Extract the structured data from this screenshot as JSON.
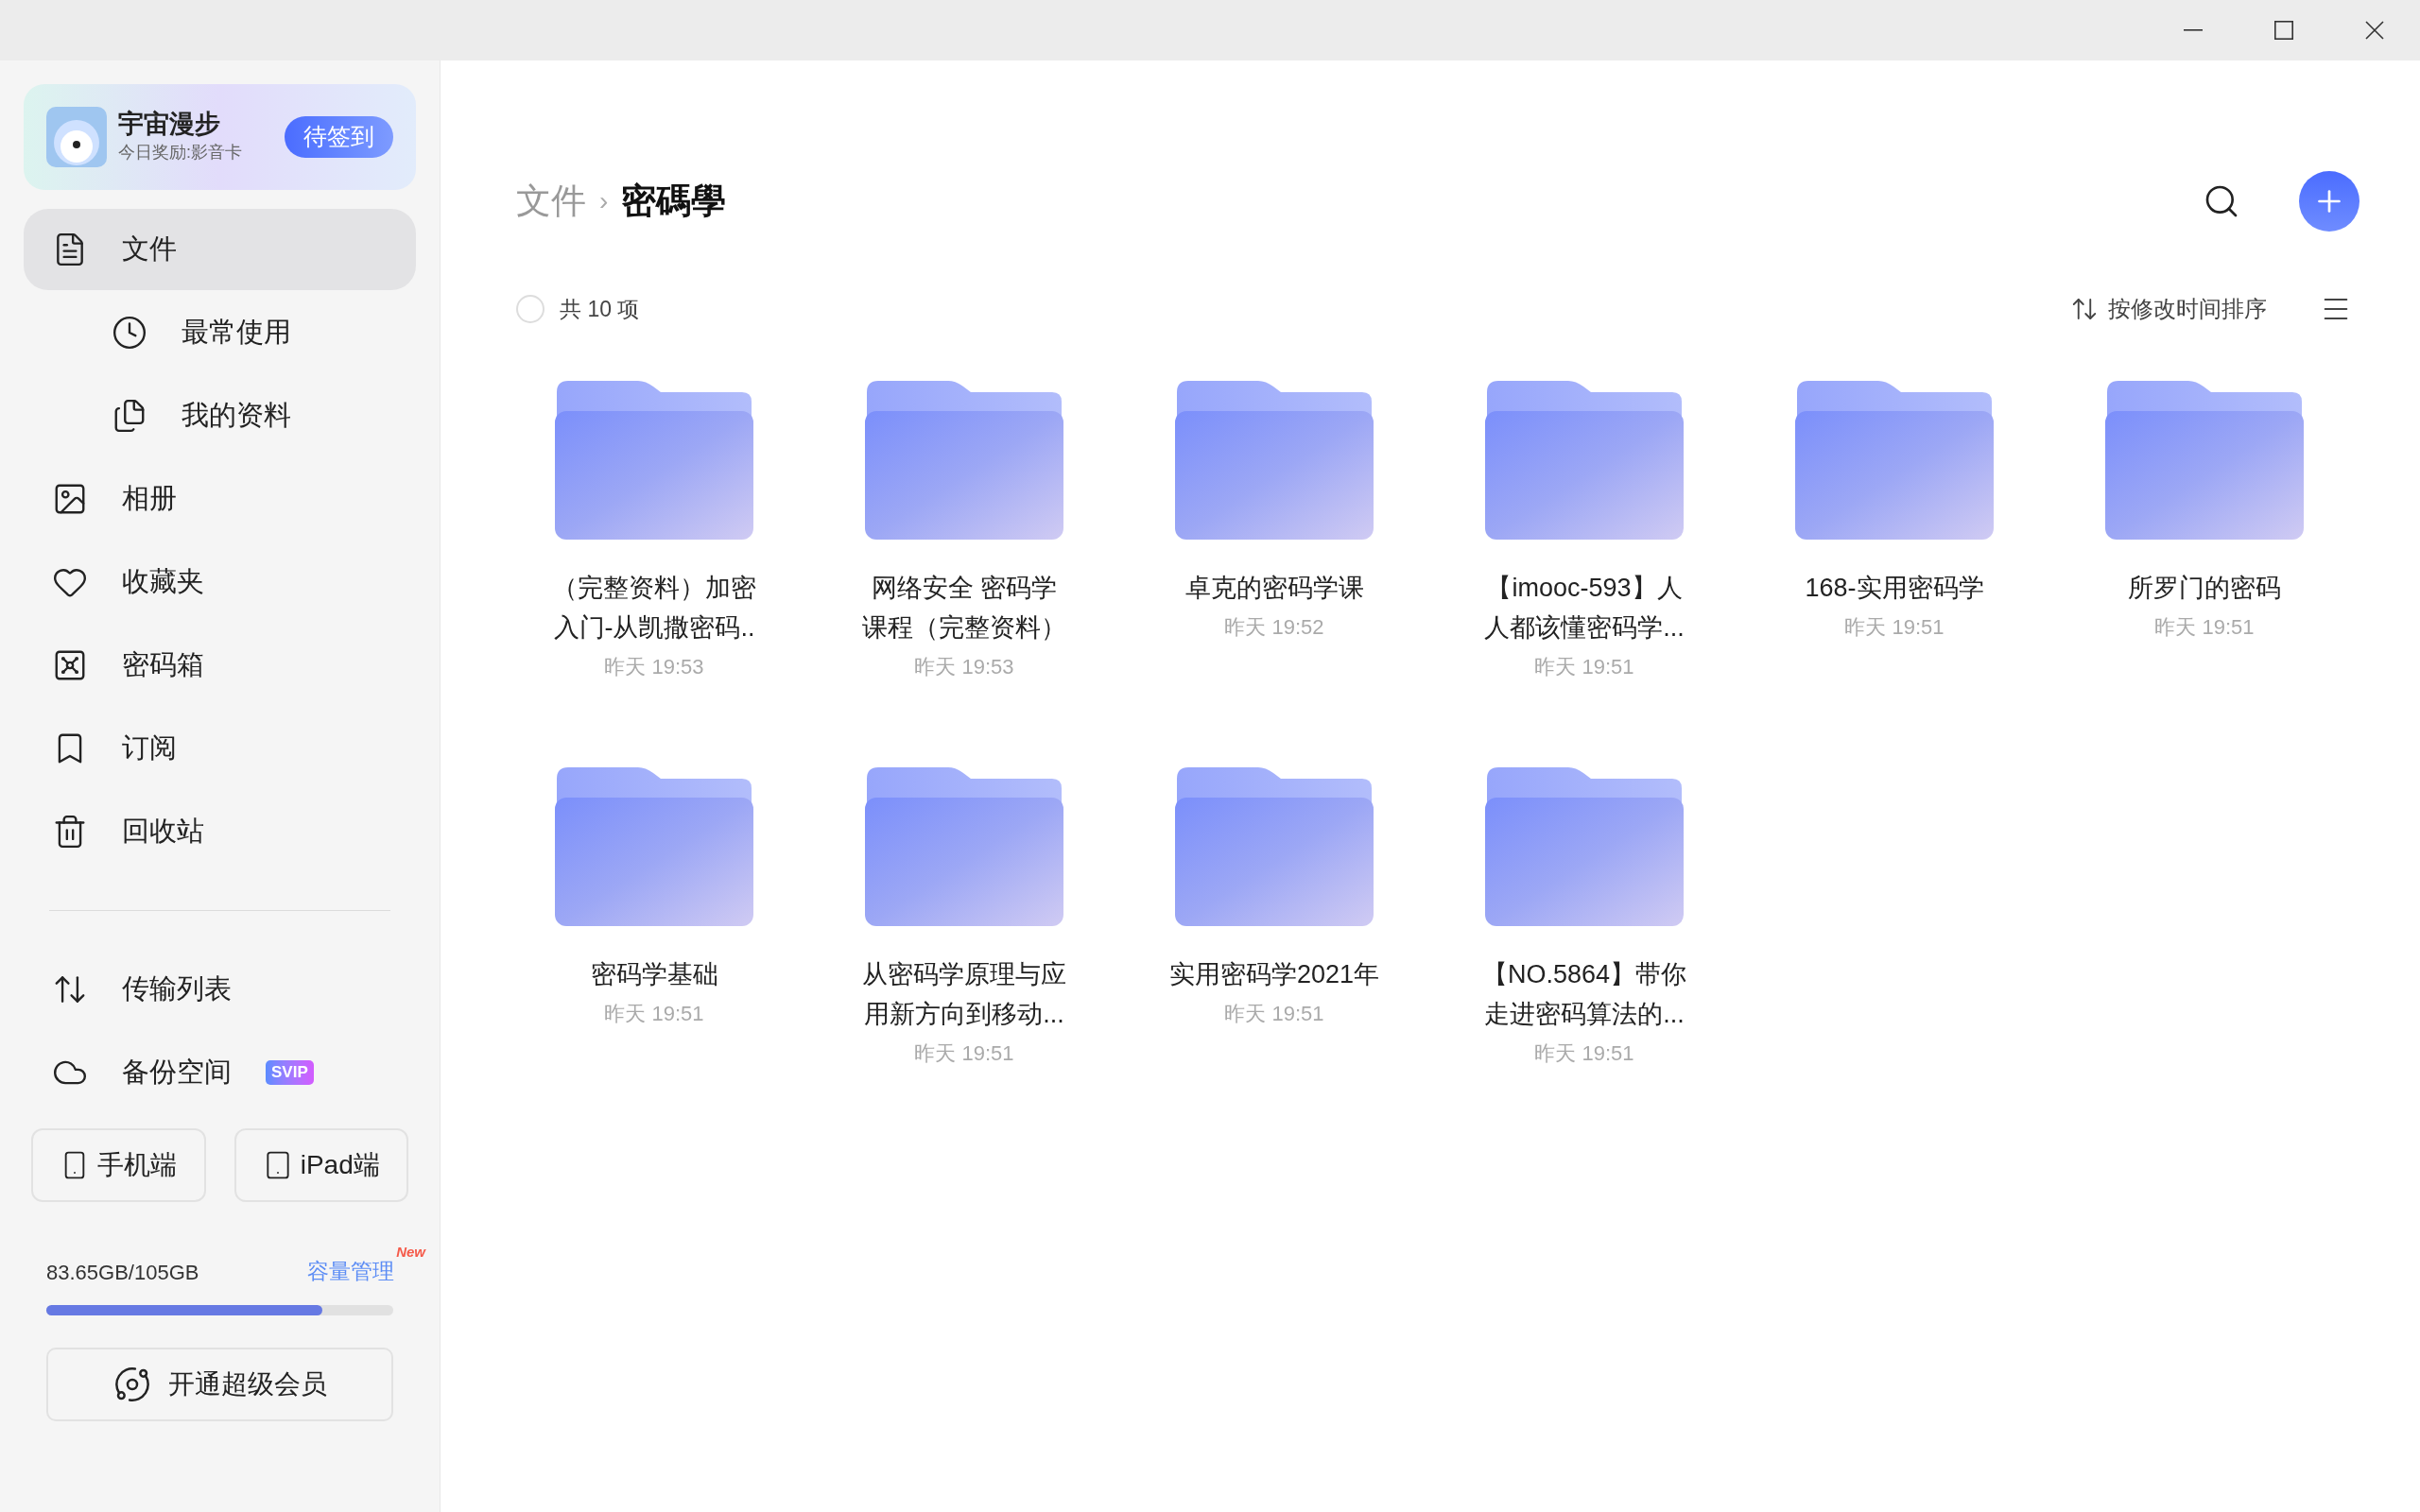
{
  "profile": {
    "name": "宇宙漫步",
    "reward": "今日奖励:影音卡",
    "checkin_button": "待签到"
  },
  "sidebar": {
    "items": [
      {
        "label": "文件",
        "selected": true,
        "children": [
          {
            "label": "最常使用",
            "selected": false
          },
          {
            "label": "我的资料",
            "selected": false
          }
        ]
      },
      {
        "label": "相册",
        "selected": false
      },
      {
        "label": "收藏夹",
        "selected": false
      },
      {
        "label": "密码箱",
        "selected": false
      },
      {
        "label": "订阅",
        "selected": false
      },
      {
        "label": "回收站",
        "selected": false
      }
    ],
    "bottom_items": [
      {
        "label": "传输列表",
        "selected": false
      },
      {
        "label": "备份空间",
        "selected": false,
        "badge": "SVIP"
      }
    ],
    "devices": [
      "手机端",
      "iPad端"
    ],
    "storage": {
      "usage": "83.65GB/105GB",
      "level": 0.797,
      "manage_link": "容量管理",
      "new_tag": "New"
    },
    "member_button": "开通超级会员"
  },
  "breadcrumb": [
    {
      "label": "文件"
    },
    {
      "label": "密碼學"
    }
  ],
  "breadcrumb_separator": "›",
  "toolbar": {
    "select_all_checked": false,
    "count": "共 10 项",
    "sort": "按修改时间排序"
  },
  "folders": [
    {
      "name_lines": [
        "（完整资料）加密",
        "入门-从凯撒密码.."
      ],
      "time": "昨天 19:53"
    },
    {
      "name_lines": [
        "网络安全 密码学",
        "课程（完整资料）"
      ],
      "time": "昨天 19:53"
    },
    {
      "name_lines": [
        "卓克的密码学课"
      ],
      "time": "昨天 19:52"
    },
    {
      "name_lines": [
        "【imooc-593】人",
        "人都该懂密码学..."
      ],
      "time": "昨天 19:51"
    },
    {
      "name_lines": [
        "168-实用密码学"
      ],
      "time": "昨天 19:51"
    },
    {
      "name_lines": [
        "所罗门的密码"
      ],
      "time": "昨天 19:51"
    },
    {
      "name_lines": [
        "密码学基础"
      ],
      "time": "昨天 19:51"
    },
    {
      "name_lines": [
        "从密码学原理与应",
        "用新方向到移动..."
      ],
      "time": "昨天 19:51"
    },
    {
      "name_lines": [
        "实用密码学2021年"
      ],
      "time": "昨天 19:51"
    },
    {
      "name_lines": [
        "【NO.5864】带你",
        "走进密码算法的..."
      ],
      "time": "昨天 19:51"
    }
  ]
}
